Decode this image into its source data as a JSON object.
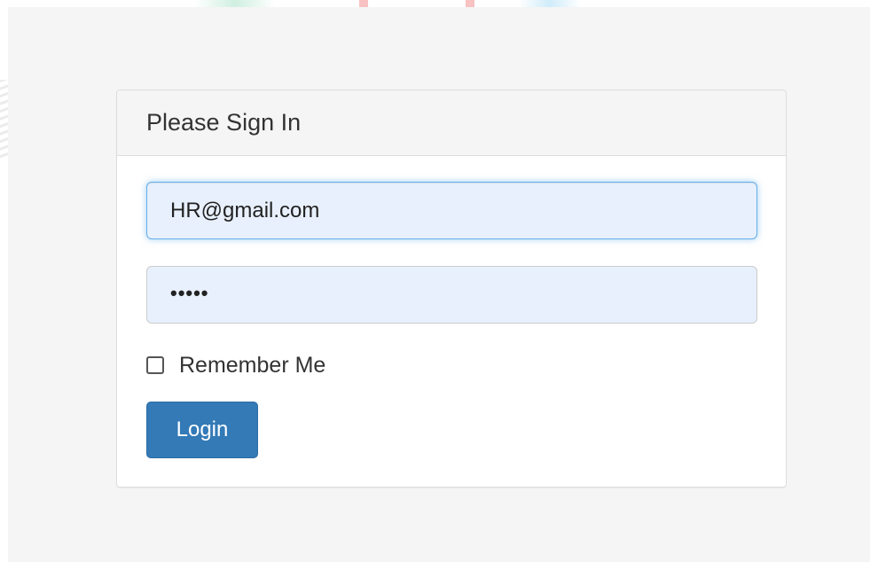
{
  "panel": {
    "title": "Please Sign In"
  },
  "form": {
    "email_value": "HR@gmail.com",
    "password_masked": "•••••",
    "remember_label": "Remember Me",
    "remember_checked": false,
    "login_label": "Login"
  },
  "colors": {
    "page_background": "#f5f5f5",
    "input_autofill": "#e8f0fe",
    "focus_border": "#66afe9",
    "primary_button": "#337ab7"
  }
}
